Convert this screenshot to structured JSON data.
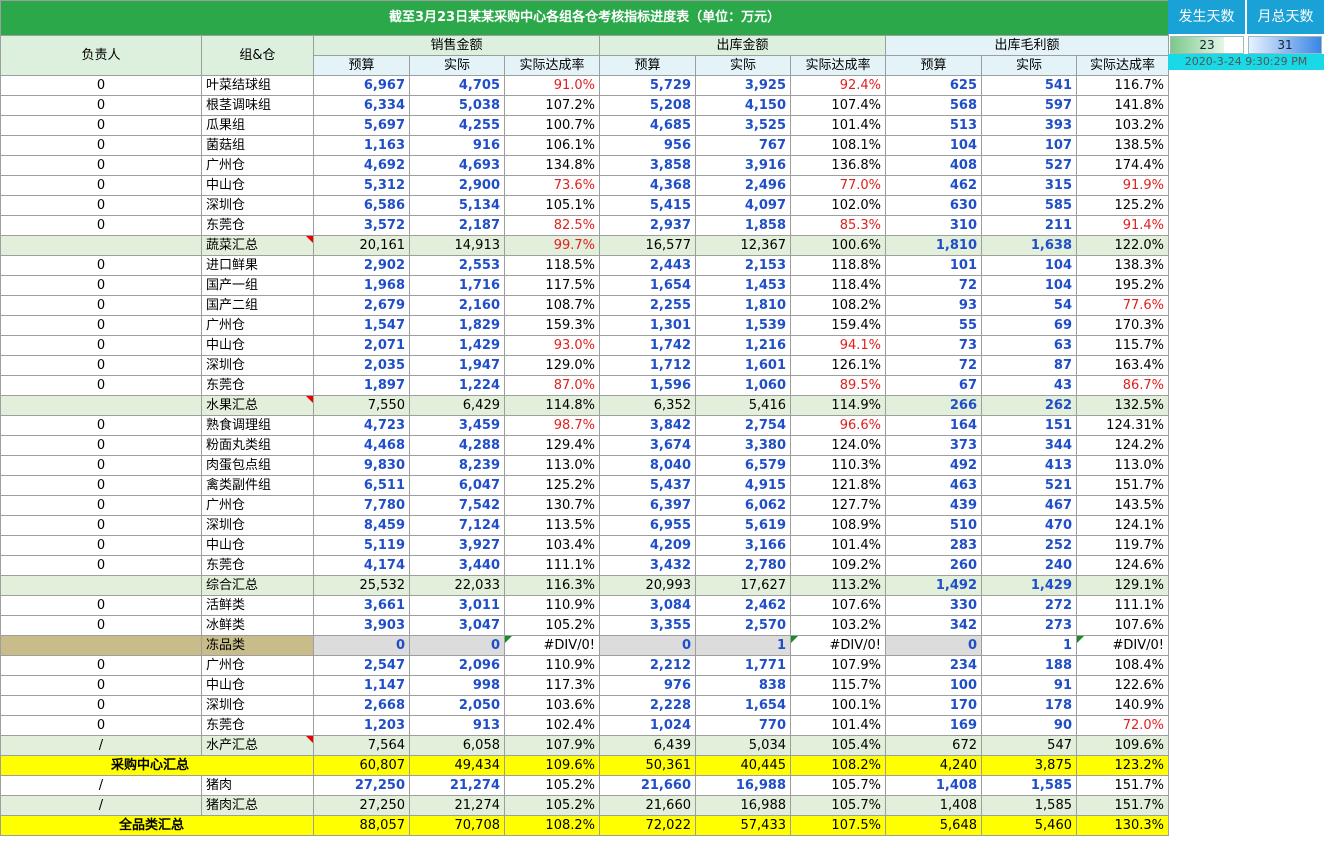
{
  "title": "截至3月23日某某采购中心各组各仓考核指标进度表（单位：万元）",
  "headers": {
    "person": "负责人",
    "group": "组&仓",
    "sales": "销售金额",
    "outbound": "出库金额",
    "margin": "出库毛利额",
    "budget": "预算",
    "actual": "实际",
    "rate": "实际达成率"
  },
  "side_panel": {
    "days_label": "发生天数",
    "month_label": "月总天数",
    "days_value": "23",
    "month_value": "31",
    "timestamp": "2020-3-24  9:30:29 PM",
    "days_fill": 0.74,
    "month_fill": 1.0
  },
  "rows": [
    {
      "type": "n",
      "p": "0",
      "g": "叶菜结球组",
      "v": [
        "6,967",
        "4,705",
        "91.0%",
        "5,729",
        "3,925",
        "92.4%",
        "625",
        "541",
        "116.7%"
      ],
      "r": [
        2,
        5
      ]
    },
    {
      "type": "n",
      "p": "0",
      "g": "根茎调味组",
      "v": [
        "6,334",
        "5,038",
        "107.2%",
        "5,208",
        "4,150",
        "107.4%",
        "568",
        "597",
        "141.8%"
      ],
      "r": []
    },
    {
      "type": "n",
      "p": "0",
      "g": "瓜果组",
      "v": [
        "5,697",
        "4,255",
        "100.7%",
        "4,685",
        "3,525",
        "101.4%",
        "513",
        "393",
        "103.2%"
      ],
      "r": []
    },
    {
      "type": "n",
      "p": "0",
      "g": "菌菇组",
      "v": [
        "1,163",
        "916",
        "106.1%",
        "956",
        "767",
        "108.1%",
        "104",
        "107",
        "138.5%"
      ],
      "r": []
    },
    {
      "type": "n",
      "p": "0",
      "g": "广州仓",
      "v": [
        "4,692",
        "4,693",
        "134.8%",
        "3,858",
        "3,916",
        "136.8%",
        "408",
        "527",
        "174.4%"
      ],
      "r": []
    },
    {
      "type": "n",
      "p": "0",
      "g": "中山仓",
      "v": [
        "5,312",
        "2,900",
        "73.6%",
        "4,368",
        "2,496",
        "77.0%",
        "462",
        "315",
        "91.9%"
      ],
      "r": [
        2,
        5,
        8
      ]
    },
    {
      "type": "n",
      "p": "0",
      "g": "深圳仓",
      "v": [
        "6,586",
        "5,134",
        "105.1%",
        "5,415",
        "4,097",
        "102.0%",
        "630",
        "585",
        "125.2%"
      ],
      "r": []
    },
    {
      "type": "n",
      "p": "0",
      "g": "东莞仓",
      "v": [
        "3,572",
        "2,187",
        "82.5%",
        "2,937",
        "1,858",
        "85.3%",
        "310",
        "211",
        "91.4%"
      ],
      "r": [
        2,
        5,
        8
      ]
    },
    {
      "type": "s",
      "p": "",
      "g": "蔬菜汇总",
      "v": [
        "20,161",
        "14,913",
        "99.7%",
        "16,577",
        "12,367",
        "100.6%",
        "1,810",
        "1,638",
        "122.0%"
      ],
      "r": [
        2
      ],
      "tri": true,
      "boldm": true
    },
    {
      "type": "n",
      "p": "0",
      "g": "进口鲜果",
      "v": [
        "2,902",
        "2,553",
        "118.5%",
        "2,443",
        "2,153",
        "118.8%",
        "101",
        "104",
        "138.3%"
      ],
      "r": []
    },
    {
      "type": "n",
      "p": "0",
      "g": "国产一组",
      "v": [
        "1,968",
        "1,716",
        "117.5%",
        "1,654",
        "1,453",
        "118.4%",
        "72",
        "104",
        "195.2%"
      ],
      "r": []
    },
    {
      "type": "n",
      "p": "0",
      "g": "国产二组",
      "v": [
        "2,679",
        "2,160",
        "108.7%",
        "2,255",
        "1,810",
        "108.2%",
        "93",
        "54",
        "77.6%"
      ],
      "r": [
        8
      ]
    },
    {
      "type": "n",
      "p": "0",
      "g": "广州仓",
      "v": [
        "1,547",
        "1,829",
        "159.3%",
        "1,301",
        "1,539",
        "159.4%",
        "55",
        "69",
        "170.3%"
      ],
      "r": []
    },
    {
      "type": "n",
      "p": "0",
      "g": "中山仓",
      "v": [
        "2,071",
        "1,429",
        "93.0%",
        "1,742",
        "1,216",
        "94.1%",
        "73",
        "63",
        "115.7%"
      ],
      "r": [
        2,
        5
      ]
    },
    {
      "type": "n",
      "p": "0",
      "g": "深圳仓",
      "v": [
        "2,035",
        "1,947",
        "129.0%",
        "1,712",
        "1,601",
        "126.1%",
        "72",
        "87",
        "163.4%"
      ],
      "r": []
    },
    {
      "type": "n",
      "p": "0",
      "g": "东莞仓",
      "v": [
        "1,897",
        "1,224",
        "87.0%",
        "1,596",
        "1,060",
        "89.5%",
        "67",
        "43",
        "86.7%"
      ],
      "r": [
        2,
        5,
        8
      ]
    },
    {
      "type": "s",
      "p": "",
      "g": "水果汇总",
      "v": [
        "7,550",
        "6,429",
        "114.8%",
        "6,352",
        "5,416",
        "114.9%",
        "266",
        "262",
        "132.5%"
      ],
      "r": [],
      "tri": true,
      "boldm": true
    },
    {
      "type": "n",
      "p": "0",
      "g": "熟食调理组",
      "v": [
        "4,723",
        "3,459",
        "98.7%",
        "3,842",
        "2,754",
        "96.6%",
        "164",
        "151",
        "124.31%"
      ],
      "r": [
        2,
        5
      ]
    },
    {
      "type": "n",
      "p": "0",
      "g": "粉面丸类组",
      "v": [
        "4,468",
        "4,288",
        "129.4%",
        "3,674",
        "3,380",
        "124.0%",
        "373",
        "344",
        "124.2%"
      ],
      "r": []
    },
    {
      "type": "n",
      "p": "0",
      "g": "肉蛋包点组",
      "v": [
        "9,830",
        "8,239",
        "113.0%",
        "8,040",
        "6,579",
        "110.3%",
        "492",
        "413",
        "113.0%"
      ],
      "r": []
    },
    {
      "type": "n",
      "p": "0",
      "g": "禽类副件组",
      "v": [
        "6,511",
        "6,047",
        "125.2%",
        "5,437",
        "4,915",
        "121.8%",
        "463",
        "521",
        "151.7%"
      ],
      "r": []
    },
    {
      "type": "n",
      "p": "0",
      "g": "广州仓",
      "v": [
        "7,780",
        "7,542",
        "130.7%",
        "6,397",
        "6,062",
        "127.7%",
        "439",
        "467",
        "143.5%"
      ],
      "r": []
    },
    {
      "type": "n",
      "p": "0",
      "g": "深圳仓",
      "v": [
        "8,459",
        "7,124",
        "113.5%",
        "6,955",
        "5,619",
        "108.9%",
        "510",
        "470",
        "124.1%"
      ],
      "r": []
    },
    {
      "type": "n",
      "p": "0",
      "g": "中山仓",
      "v": [
        "5,119",
        "3,927",
        "103.4%",
        "4,209",
        "3,166",
        "101.4%",
        "283",
        "252",
        "119.7%"
      ],
      "r": []
    },
    {
      "type": "n",
      "p": "0",
      "g": "东莞仓",
      "v": [
        "4,174",
        "3,440",
        "111.1%",
        "3,432",
        "2,780",
        "109.2%",
        "260",
        "240",
        "124.6%"
      ],
      "r": []
    },
    {
      "type": "s",
      "p": "",
      "g": "综合汇总",
      "v": [
        "25,532",
        "22,033",
        "116.3%",
        "20,993",
        "17,627",
        "113.2%",
        "1,492",
        "1,429",
        "129.1%"
      ],
      "r": [],
      "boldm": true
    },
    {
      "type": "n",
      "p": "0",
      "g": "活鲜类",
      "v": [
        "3,661",
        "3,011",
        "110.9%",
        "3,084",
        "2,462",
        "107.6%",
        "330",
        "272",
        "111.1%"
      ],
      "r": []
    },
    {
      "type": "n",
      "p": "0",
      "g": "冰鲜类",
      "v": [
        "3,903",
        "3,047",
        "105.2%",
        "3,355",
        "2,570",
        "103.2%",
        "342",
        "273",
        "107.6%"
      ],
      "r": []
    },
    {
      "type": "d",
      "p": "",
      "g": "冻品类",
      "v": [
        "0",
        "0",
        "#DIV/0!",
        "0",
        "1",
        "#DIV/0!",
        "0",
        "1",
        "#DIV/0!"
      ],
      "r": []
    },
    {
      "type": "n",
      "p": "0",
      "g": "广州仓",
      "v": [
        "2,547",
        "2,096",
        "110.9%",
        "2,212",
        "1,771",
        "107.9%",
        "234",
        "188",
        "108.4%"
      ],
      "r": []
    },
    {
      "type": "n",
      "p": "0",
      "g": "中山仓",
      "v": [
        "1,147",
        "998",
        "117.3%",
        "976",
        "838",
        "115.7%",
        "100",
        "91",
        "122.6%"
      ],
      "r": []
    },
    {
      "type": "n",
      "p": "0",
      "g": "深圳仓",
      "v": [
        "2,668",
        "2,050",
        "103.6%",
        "2,228",
        "1,654",
        "100.1%",
        "170",
        "178",
        "140.9%"
      ],
      "r": []
    },
    {
      "type": "n",
      "p": "0",
      "g": "东莞仓",
      "v": [
        "1,203",
        "913",
        "102.4%",
        "1,024",
        "770",
        "101.4%",
        "169",
        "90",
        "72.0%"
      ],
      "r": [
        8
      ]
    },
    {
      "type": "s",
      "p": "/",
      "g": "水产汇总",
      "v": [
        "7,564",
        "6,058",
        "107.9%",
        "6,439",
        "5,034",
        "105.4%",
        "672",
        "547",
        "109.6%"
      ],
      "r": [],
      "tri": true
    },
    {
      "type": "y",
      "p": "",
      "g": "采购中心汇总",
      "v": [
        "60,807",
        "49,434",
        "109.6%",
        "50,361",
        "40,445",
        "108.2%",
        "4,240",
        "3,875",
        "123.2%"
      ],
      "r": []
    },
    {
      "type": "n",
      "p": "/",
      "g": "猪肉",
      "v": [
        "27,250",
        "21,274",
        "105.2%",
        "21,660",
        "16,988",
        "105.7%",
        "1,408",
        "1,585",
        "151.7%"
      ],
      "r": []
    },
    {
      "type": "s",
      "p": "/",
      "g": "猪肉汇总",
      "v": [
        "27,250",
        "21,274",
        "105.2%",
        "21,660",
        "16,988",
        "105.7%",
        "1,408",
        "1,585",
        "151.7%"
      ],
      "r": []
    },
    {
      "type": "y",
      "p": "",
      "g": "全品类汇总",
      "v": [
        "88,057",
        "70,708",
        "108.2%",
        "72,022",
        "57,433",
        "107.5%",
        "5,648",
        "5,460",
        "130.3%"
      ],
      "r": []
    }
  ]
}
